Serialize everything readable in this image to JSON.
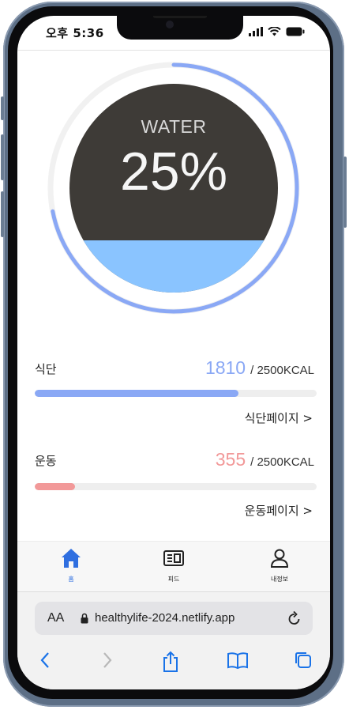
{
  "status_bar": {
    "time": "오후 5:36"
  },
  "water": {
    "title": "WATER",
    "percent_label": "25%",
    "progress": 0.25,
    "ring_color": "#8aa8f5",
    "fill_color": "#8ac4ff",
    "circle_color": "#3e3b37"
  },
  "diet": {
    "label": "식단",
    "value": "1810",
    "goal": "/ 2500KCAL",
    "progress": 0.724,
    "color": "#8aa8f5",
    "link": "식단페이지 >"
  },
  "exercise": {
    "label": "운동",
    "value": "355",
    "goal": "/ 2500KCAL",
    "progress": 0.142,
    "color": "#f29999",
    "link": "운동페이지 >"
  },
  "tabs": [
    {
      "label": "홈",
      "icon": "home-icon",
      "active": true
    },
    {
      "label": "피드",
      "icon": "feed-icon",
      "active": false
    },
    {
      "label": "내정보",
      "icon": "profile-icon",
      "active": false
    }
  ],
  "browser": {
    "aa_label": "AA",
    "url": "healthylife-2024.netlify.app"
  },
  "colors": {
    "accent": "#2f6fe0",
    "icon_blue": "#1a73e8"
  }
}
